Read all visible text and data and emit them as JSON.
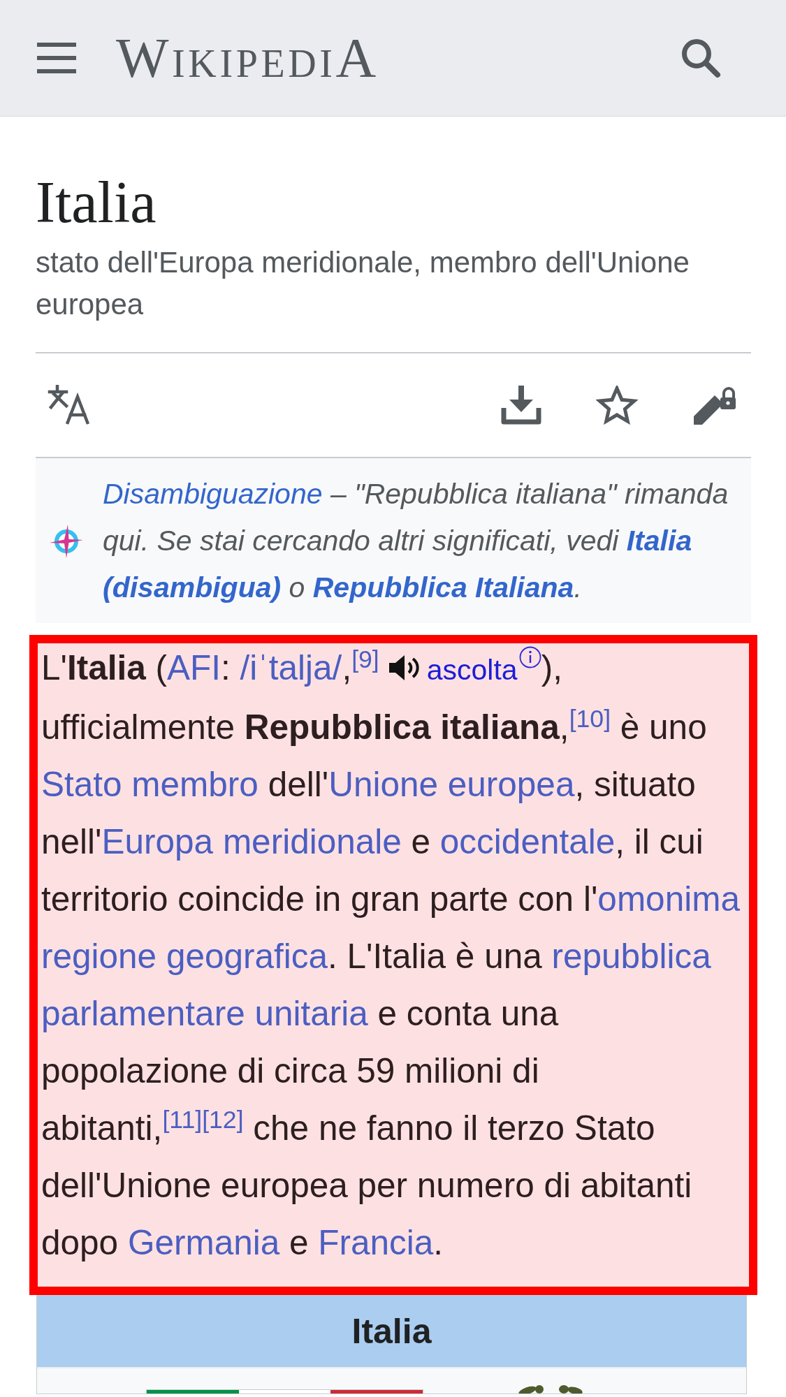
{
  "header": {
    "logo_text": "WikipediA"
  },
  "page": {
    "title": "Italia",
    "description": "stato dell'Europa meridionale, membro dell'Unione europea"
  },
  "toolbar": {
    "watched": false
  },
  "hatnote": {
    "segments": [
      {
        "kind": "link",
        "text": "Disambiguazione",
        "bold": false
      },
      {
        "kind": "text",
        "text": " – \"Repubblica italiana\" rimanda qui. Se stai cercando altri significati, vedi "
      },
      {
        "kind": "link",
        "parts": [
          "Italia",
          "(disambigua)"
        ],
        "bold": true
      },
      {
        "kind": "text",
        "text": " o "
      },
      {
        "kind": "link",
        "text": "Repubblica Italiana",
        "bold": true
      },
      {
        "kind": "text",
        "text": "."
      }
    ]
  },
  "lead": {
    "highlighted": true,
    "segments": [
      {
        "kind": "text",
        "text": "L'**Italia** ("
      },
      {
        "kind": "link",
        "text": "AFI"
      },
      {
        "kind": "text",
        "text": ": "
      },
      {
        "kind": "link",
        "text": "/iˈtalja/"
      },
      {
        "kind": "text",
        "text": ","
      },
      {
        "kind": "ref",
        "text": "[9]"
      },
      {
        "kind": "audio",
        "text": "ascolta"
      },
      {
        "kind": "text",
        "text": "), ufficialmente **Repubblica italiana**,"
      },
      {
        "kind": "ref",
        "text": "[10]"
      },
      {
        "kind": "text",
        "text": " è uno "
      },
      {
        "kind": "link",
        "text": "Stato membro"
      },
      {
        "kind": "text",
        "text": " dell'"
      },
      {
        "kind": "link",
        "text": "Unione europea"
      },
      {
        "kind": "text",
        "text": ", situato nell'"
      },
      {
        "kind": "link",
        "text": "Europa meridionale"
      },
      {
        "kind": "text",
        "text": " e "
      },
      {
        "kind": "link",
        "text": "occidentale"
      },
      {
        "kind": "text",
        "text": ", il cui territorio coincide in gran parte con l'"
      },
      {
        "kind": "link",
        "parts": [
          "omonima",
          "regione geografica"
        ]
      },
      {
        "kind": "text",
        "text": ". L'Italia è una "
      },
      {
        "kind": "link",
        "parts": [
          "repubblica",
          "parlamentare unitaria"
        ]
      },
      {
        "kind": "text",
        "text": " e conta una popolazione di circa 59 milioni di abitanti,"
      },
      {
        "kind": "ref",
        "text": "[11]"
      },
      {
        "kind": "ref",
        "text": "[12]"
      },
      {
        "kind": "text",
        "text": " che ne fanno il terzo Stato dell'Unione europea per numero di abitanti dopo "
      },
      {
        "kind": "link",
        "text": "Germania"
      },
      {
        "kind": "text",
        "text": " e "
      },
      {
        "kind": "link",
        "text": "Francia"
      },
      {
        "kind": "text",
        "text": "."
      }
    ]
  },
  "infobox": {
    "title": "Italia"
  }
}
